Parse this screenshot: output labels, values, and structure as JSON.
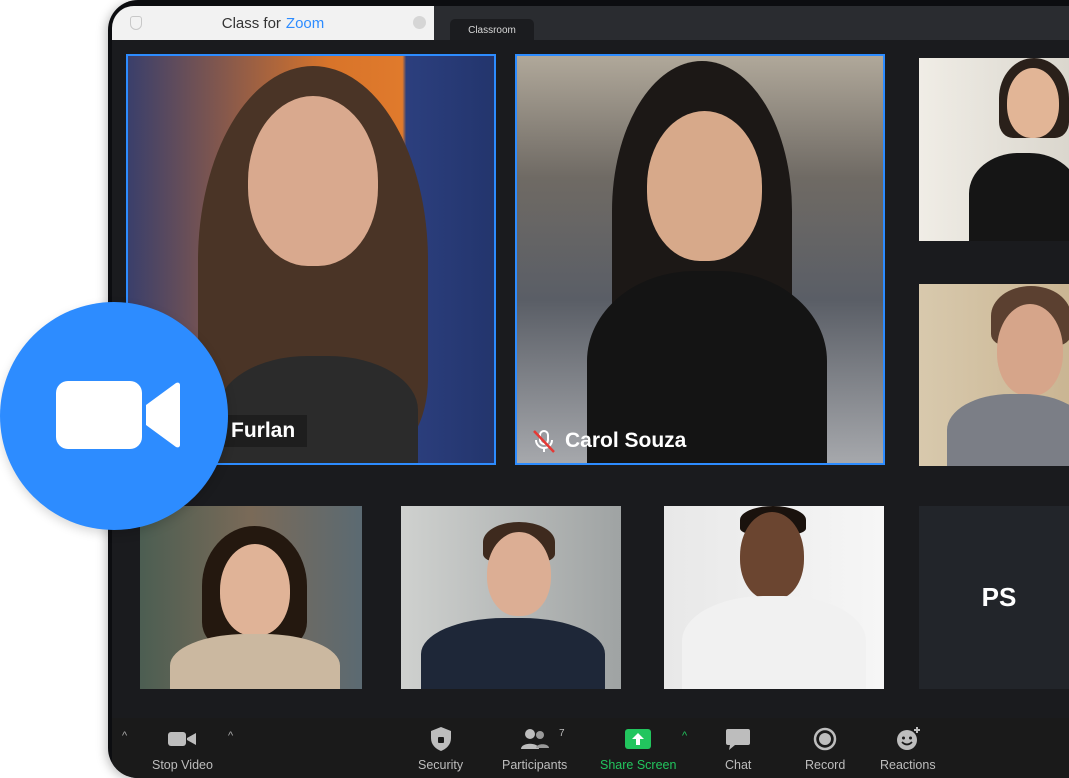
{
  "window": {
    "title_prefix": "Class for",
    "title_brand": "Zoom",
    "tab": "Classroom"
  },
  "participants": [
    {
      "name": "Furlan",
      "active": true,
      "muted": false
    },
    {
      "name": "Carol Souza",
      "active": true,
      "muted": true
    },
    {
      "name": "",
      "active": false,
      "muted": false
    },
    {
      "name": "",
      "active": false,
      "muted": false
    },
    {
      "name": "",
      "active": false,
      "muted": false
    },
    {
      "name": "",
      "active": false,
      "muted": false
    },
    {
      "name": "",
      "active": false,
      "muted": false
    },
    {
      "initials": "PS"
    }
  ],
  "toolbar": {
    "stop_video": "Stop Video",
    "security": "Security",
    "participants": "Participants",
    "participants_count": "7",
    "share_screen": "Share Screen",
    "chat": "Chat",
    "record": "Record",
    "reactions": "Reactions"
  },
  "colors": {
    "accent": "#2d8cff",
    "share_green": "#22c55e",
    "toolbar_bg": "#1a1a1a"
  },
  "icons": [
    "video-camera-icon",
    "shield-icon",
    "participants-icon",
    "share-screen-icon",
    "chat-icon",
    "record-icon",
    "reactions-icon",
    "muted-mic-icon",
    "zoom-camera-logo"
  ]
}
